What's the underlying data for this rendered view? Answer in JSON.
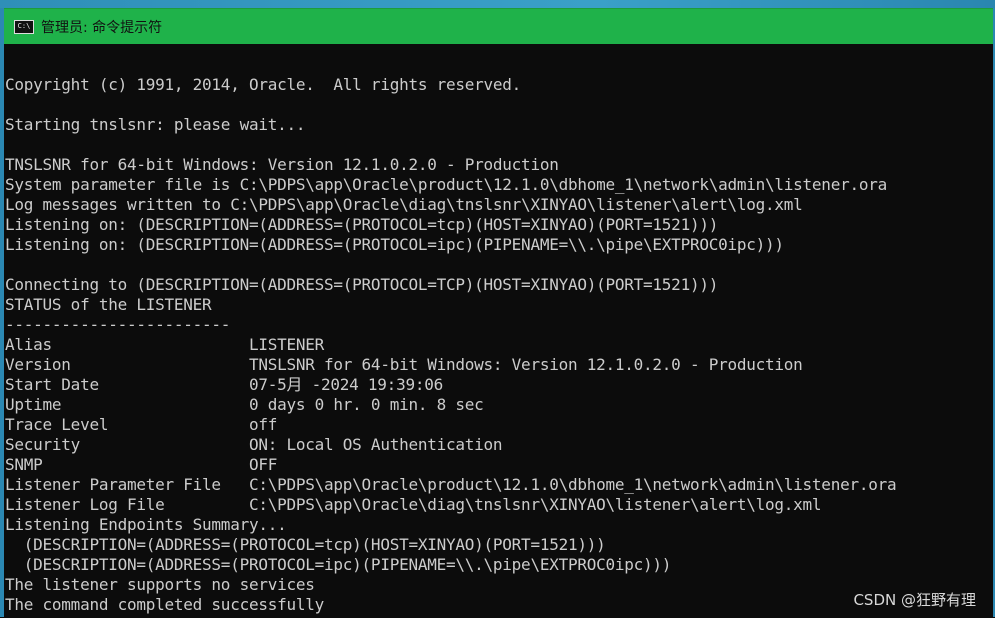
{
  "window": {
    "title": "管理员: 命令提示符",
    "icon": "cmd-icon",
    "icon_text": "C:\\"
  },
  "console_lines": [
    "",
    "Copyright (c) 1991, 2014, Oracle.  All rights reserved.",
    "",
    "Starting tnslsnr: please wait...",
    "",
    "TNSLSNR for 64-bit Windows: Version 12.1.0.2.0 - Production",
    "System parameter file is C:\\PDPS\\app\\Oracle\\product\\12.1.0\\dbhome_1\\network\\admin\\listener.ora",
    "Log messages written to C:\\PDPS\\app\\Oracle\\diag\\tnslsnr\\XINYAO\\listener\\alert\\log.xml",
    "Listening on: (DESCRIPTION=(ADDRESS=(PROTOCOL=tcp)(HOST=XINYAO)(PORT=1521)))",
    "Listening on: (DESCRIPTION=(ADDRESS=(PROTOCOL=ipc)(PIPENAME=\\\\.\\pipe\\EXTPROC0ipc)))",
    "",
    "Connecting to (DESCRIPTION=(ADDRESS=(PROTOCOL=TCP)(HOST=XINYAO)(PORT=1521)))",
    "STATUS of the LISTENER",
    "------------------------",
    "Alias                     LISTENER",
    "Version                   TNSLSNR for 64-bit Windows: Version 12.1.0.2.0 - Production",
    "Start Date                07-5月 -2024 19:39:06",
    "Uptime                    0 days 0 hr. 0 min. 8 sec",
    "Trace Level               off",
    "Security                  ON: Local OS Authentication",
    "SNMP                      OFF",
    "Listener Parameter File   C:\\PDPS\\app\\Oracle\\product\\12.1.0\\dbhome_1\\network\\admin\\listener.ora",
    "Listener Log File         C:\\PDPS\\app\\Oracle\\diag\\tnslsnr\\XINYAO\\listener\\alert\\log.xml",
    "Listening Endpoints Summary...",
    "  (DESCRIPTION=(ADDRESS=(PROTOCOL=tcp)(HOST=XINYAO)(PORT=1521)))",
    "  (DESCRIPTION=(ADDRESS=(PROTOCOL=ipc)(PIPENAME=\\\\.\\pipe\\EXTPROC0ipc)))",
    "The listener supports no services",
    "The command completed successfully"
  ],
  "watermark": "CSDN @狂野有理",
  "colors": {
    "titlebar": "#1fb24a",
    "console_bg": "#0c0c0c",
    "console_text": "#cccccc"
  }
}
